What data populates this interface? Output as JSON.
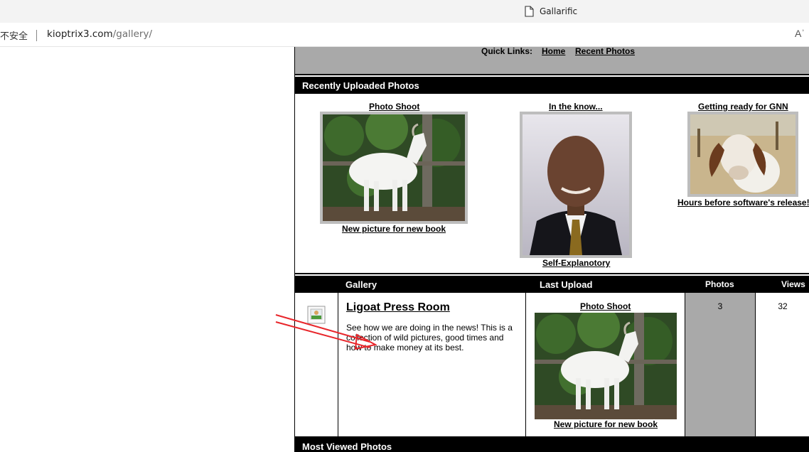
{
  "browser": {
    "tab_title": "Gallarific",
    "security_label": "不安全",
    "url_host": "kioptrix3.com",
    "url_path": "/gallery/",
    "read_aloud_glyph": "Aʾ"
  },
  "quick_links": {
    "label": "Quick Links:",
    "home": "Home",
    "recent": "Recent Photos"
  },
  "recent_section": {
    "title": "Recently Uploaded Photos",
    "photos": [
      {
        "title": "Photo Shoot",
        "caption": "New picture for new book"
      },
      {
        "title": "In the know...",
        "caption": "Self-Explanotory"
      },
      {
        "title": "Getting ready for GNN",
        "caption": "Hours before software's release!"
      }
    ]
  },
  "gallery_table": {
    "headers": {
      "gallery": "Gallery",
      "last_upload": "Last Upload",
      "photos": "Photos",
      "views": "Views"
    },
    "rows": [
      {
        "name": "Ligoat Press Room",
        "description": "See how we are doing in the news! This is a collection of wild pictures, good times and how to make money at its best.",
        "last_upload_title": "Photo Shoot",
        "last_upload_caption": "New picture for new book",
        "photos": "3",
        "views": "32"
      }
    ]
  },
  "most_viewed_section": {
    "title": "Most Viewed Photos"
  },
  "colors": {
    "header_bg": "#000000",
    "gray_band": "#a9a9a9",
    "annotation_arrow": "#e8262b"
  }
}
